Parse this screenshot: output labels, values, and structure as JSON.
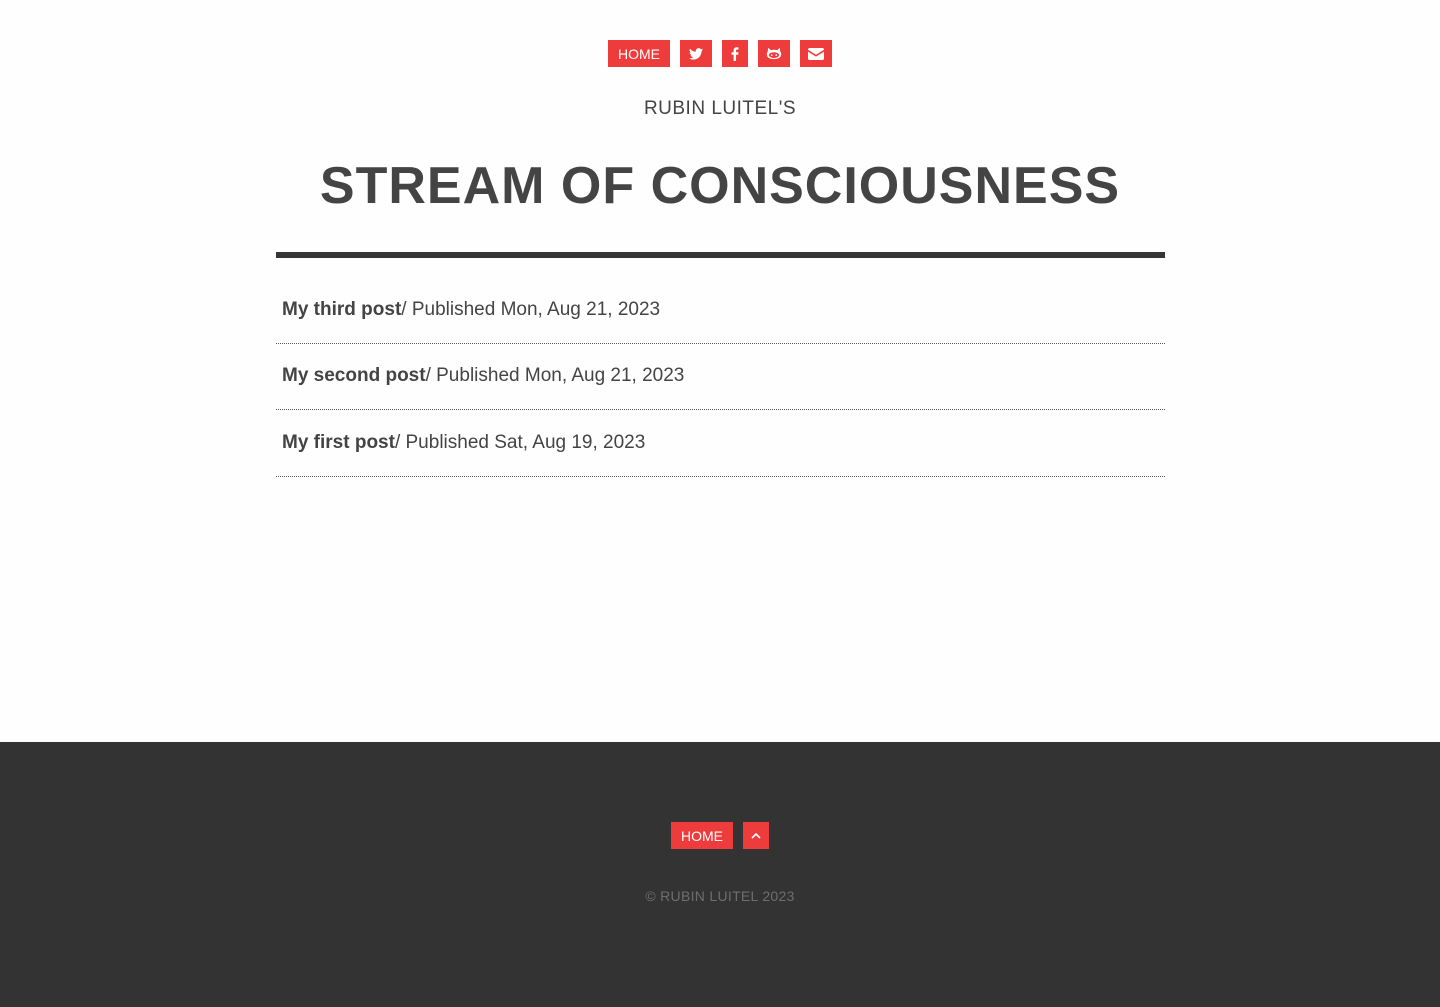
{
  "header": {
    "nav": {
      "home_label": "HOME",
      "icons": [
        "twitter-icon",
        "facebook-icon",
        "github-icon",
        "envelope-icon"
      ]
    },
    "subtitle": "RUBIN LUITEL'S",
    "title": "STREAM OF CONSCIOUSNESS"
  },
  "posts": [
    {
      "title": "My third post",
      "meta": "/ Published Mon, Aug 21, 2023"
    },
    {
      "title": "My second post",
      "meta": "/ Published Mon, Aug 21, 2023"
    },
    {
      "title": "My first post",
      "meta": "/ Published Sat, Aug 19, 2023"
    }
  ],
  "footer": {
    "home_label": "HOME",
    "top_icon": "chevron-up-icon",
    "copyright": "© RUBIN LUITEL 2023"
  },
  "colors": {
    "accent": "#ee3b3b",
    "text": "#444444",
    "footer_bg": "#333333",
    "page_bg": "#fefefe"
  }
}
